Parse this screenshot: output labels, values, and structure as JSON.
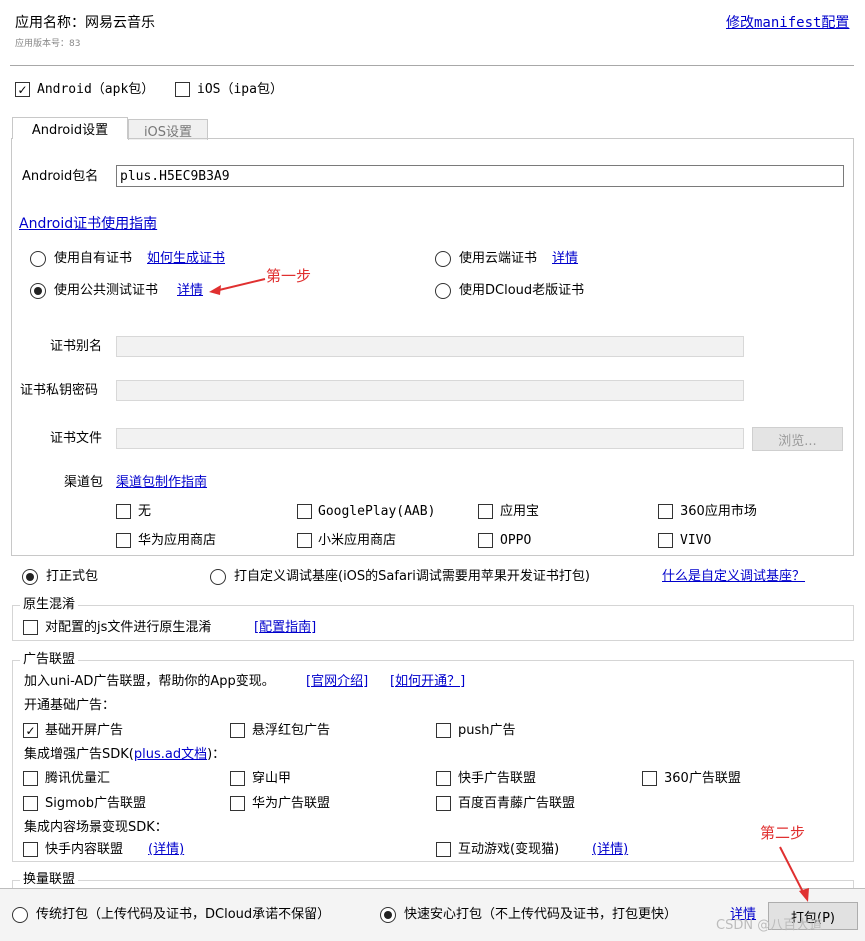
{
  "app": {
    "name_label": "应用名称：网易云音乐",
    "version_label": "应用版本号：83",
    "manifest_link": "修改manifest配置"
  },
  "platforms": {
    "android_label": "Android（apk包）",
    "android_checked": true,
    "ios_label": "iOS（ipa包）",
    "ios_checked": false
  },
  "tabs": [
    {
      "label": "Android设置",
      "active": true
    },
    {
      "label": "iOS设置",
      "active": false
    }
  ],
  "android": {
    "package_label": "Android包名",
    "package_value": "plus.H5EC9B3A9",
    "cert_guide_link": "Android证书使用指南",
    "cert_options": {
      "own_label": "使用自有证书",
      "own_link": "如何生成证书",
      "cloud_label": "使用云端证书",
      "cloud_link": "详情",
      "public_label": "使用公共测试证书",
      "public_link": "详情",
      "legacy_label": "使用DCloud老版证书"
    },
    "alias_label": "证书别名",
    "password_label": "证书私钥密码",
    "file_label": "证书文件",
    "browse_button": "浏览...",
    "channel_label": "渠道包",
    "channel_link": "渠道包制作指南",
    "channels": [
      {
        "label": "无",
        "checked": false
      },
      {
        "label": "GooglePlay(AAB)",
        "checked": false
      },
      {
        "label": "应用宝",
        "checked": false
      },
      {
        "label": "360应用市场",
        "checked": false
      },
      {
        "label": "华为应用商店",
        "checked": false
      },
      {
        "label": "小米应用商店",
        "checked": false
      },
      {
        "label": "OPPO",
        "checked": false
      },
      {
        "label": "VIVO",
        "checked": false
      }
    ]
  },
  "build_mode": {
    "release_label": "打正式包",
    "debug_label": "打自定义调试基座(iOS的Safari调试需要用苹果开发证书打包)",
    "debug_link": "什么是自定义调试基座？"
  },
  "obfuscation": {
    "title": "原生混淆",
    "option_label": "对配置的js文件进行原生混淆",
    "guide_link": "[配置指南]"
  },
  "ads": {
    "title": "广告联盟",
    "intro": "加入uni-AD广告联盟，帮助你的App变现。",
    "official_link": "[官网介绍]",
    "howto_link": "[如何开通？]",
    "basic_title": "开通基础广告：",
    "basic": [
      {
        "label": "基础开屏广告",
        "checked": true
      },
      {
        "label": "悬浮红包广告",
        "checked": false
      },
      {
        "label": "push广告",
        "checked": false
      }
    ],
    "sdk_title_pre": "集成增强广告SDK(",
    "sdk_doc_link": "plus.ad文档",
    "sdk_title_post": ")：",
    "sdk": [
      {
        "label": "腾讯优量汇",
        "checked": false
      },
      {
        "label": "穿山甲",
        "checked": false
      },
      {
        "label": "快手广告联盟",
        "checked": false
      },
      {
        "label": "360广告联盟",
        "checked": false
      },
      {
        "label": "Sigmob广告联盟",
        "checked": false
      },
      {
        "label": "华为广告联盟",
        "checked": false
      },
      {
        "label": "百度百青藤广告联盟",
        "checked": false
      }
    ],
    "content_title": "集成内容场景变现SDK：",
    "content": [
      {
        "label": "快手内容联盟",
        "link": "(详情)",
        "checked": false
      },
      {
        "label": "互动游戏(变现猫)",
        "link": "(详情)",
        "checked": false
      }
    ]
  },
  "exchange": {
    "title": "换量联盟"
  },
  "footer": {
    "traditional_label": "传统打包（上传代码及证书，DCloud承诺不保留）",
    "fast_label": "快速安心打包（不上传代码及证书，打包更快）",
    "details_link": "详情",
    "pack_button": "打包(P)"
  },
  "annotations": {
    "step1": "第一步",
    "step2": "第二步"
  },
  "watermark": "CSDN @八百大道",
  "colors": {
    "link": "#0000cc",
    "annotation": "#e03030"
  }
}
